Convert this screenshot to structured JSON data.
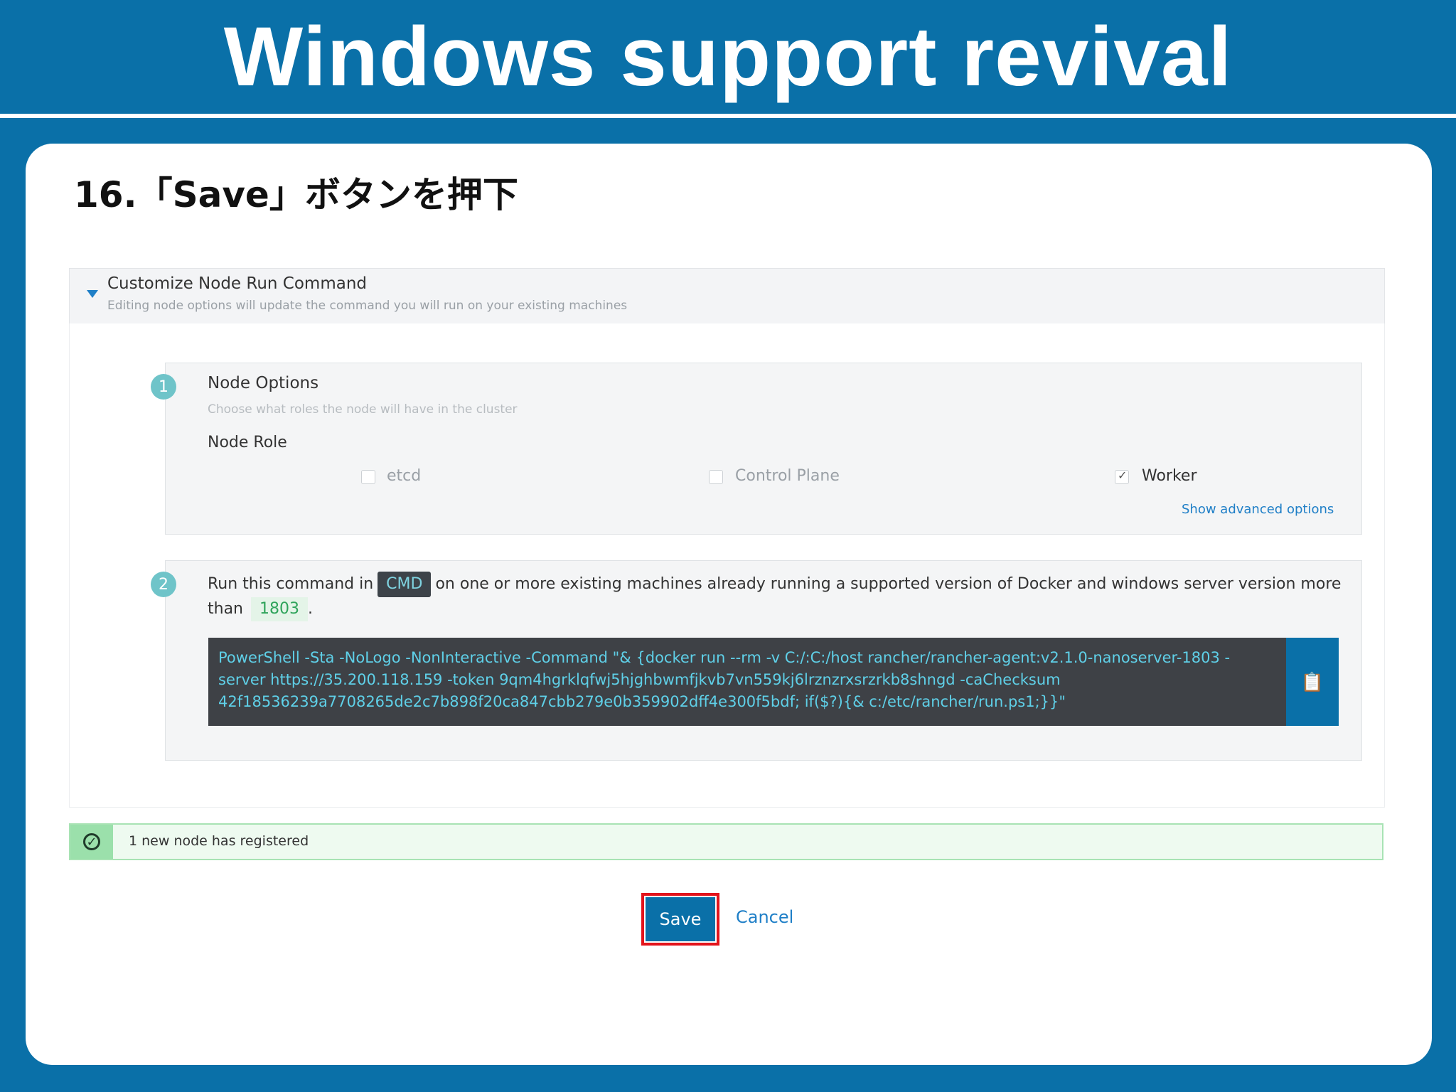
{
  "slide": {
    "title": "Windows support revival",
    "step_heading": "16.「Save」ボタンを押下"
  },
  "accordion": {
    "title": "Customize Node Run Command",
    "subtitle": "Editing node options will update the command you will run on your existing machines"
  },
  "node_options": {
    "step_number": "1",
    "title": "Node Options",
    "subtitle": "Choose what roles the node will have in the cluster",
    "role_label": "Node Role",
    "roles": [
      {
        "label": "etcd",
        "checked": false
      },
      {
        "label": "Control Plane",
        "checked": false
      },
      {
        "label": "Worker",
        "checked": true
      }
    ],
    "advanced_link": "Show advanced options"
  },
  "run_command": {
    "step_number": "2",
    "text_before": "Run this command in",
    "shell_badge": "CMD",
    "text_after": "on one or more existing machines already running a supported version of Docker and windows server version more than",
    "version_badge": "1803",
    "text_end": ".",
    "command": "PowerShell -Sta -NoLogo -NonInteractive -Command \"& {docker run --rm -v C:/:C:/host rancher/rancher-agent:v2.1.0-nanoserver-1803 -server https://35.200.118.159 -token 9qm4hgrklqfwj5hjghbwmfjkvb7vn559kj6lrznzrxsrzrkb8shngd -caChecksum 42f18536239a7708265de2c7b898f20ca847cbb279e0b359902dff4e300f5bdf; if($?){& c:/etc/rancher/run.ps1;}}\"",
    "copy_icon": "clipboard-icon"
  },
  "alert": {
    "icon": "check-circle-icon",
    "text": "1 new node has registered"
  },
  "actions": {
    "save_label": "Save",
    "cancel_label": "Cancel"
  },
  "colors": {
    "brand_blue": "#0a70a8",
    "highlight_red": "#e3141c",
    "success_green": "#9be0ab"
  }
}
